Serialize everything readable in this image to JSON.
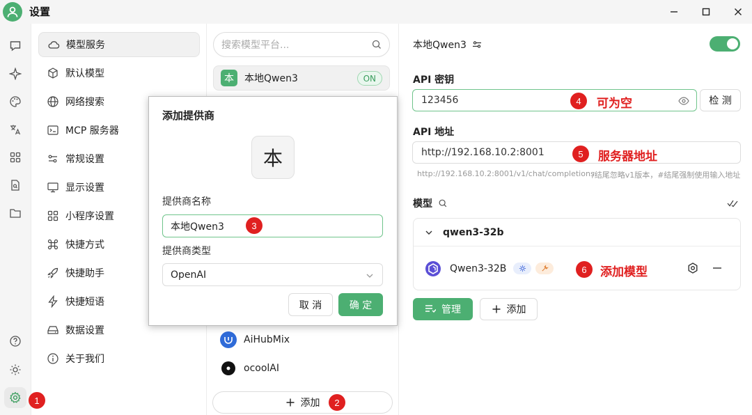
{
  "window": {
    "title": "设置"
  },
  "nav": {
    "items": [
      {
        "label": "模型服务"
      },
      {
        "label": "默认模型"
      },
      {
        "label": "网络搜索"
      },
      {
        "label": "MCP 服务器"
      },
      {
        "label": "常规设置"
      },
      {
        "label": "显示设置"
      },
      {
        "label": "小程序设置"
      },
      {
        "label": "快捷方式"
      },
      {
        "label": "快捷助手"
      },
      {
        "label": "快捷短语"
      },
      {
        "label": "数据设置"
      },
      {
        "label": "关于我们"
      }
    ]
  },
  "providers": {
    "search_placeholder": "搜索模型平台...",
    "items": [
      {
        "label": "本地Qwen3",
        "logo_char": "本",
        "badge": "ON"
      },
      {
        "label": "AiHubMix"
      },
      {
        "label": "ocoolAI"
      }
    ],
    "add_label": "添加"
  },
  "detail": {
    "title": "本地Qwen3",
    "api_key": {
      "label": "API 密钥",
      "value": "123456",
      "check_label": "检 测"
    },
    "api_url": {
      "label": "API 地址",
      "value": "http://192.168.10.2:8001",
      "hint_url": "http://192.168.10.2:8001/v1/chat/completions",
      "hint_note": "/结尾忽略v1版本，#结尾强制使用输入地址"
    },
    "models": {
      "label": "模型",
      "group_name": "qwen3-32b",
      "model_name": "Qwen3-32B",
      "manage_label": "管理",
      "add_label": "添加"
    }
  },
  "dialog": {
    "title": "添加提供商",
    "logo_char": "本",
    "name_label": "提供商名称",
    "name_value": "本地Qwen3",
    "type_label": "提供商类型",
    "type_value": "OpenAI",
    "cancel_label": "取 消",
    "ok_label": "确 定"
  },
  "annotations": {
    "m1": "1",
    "m2": "2",
    "m3": "3",
    "m4": "4",
    "m5": "5",
    "m6": "6",
    "t4": "可为空",
    "t5": "服务器地址",
    "t6": "添加模型"
  },
  "colors": {
    "accent": "#4caf72",
    "marker": "#e02020"
  }
}
